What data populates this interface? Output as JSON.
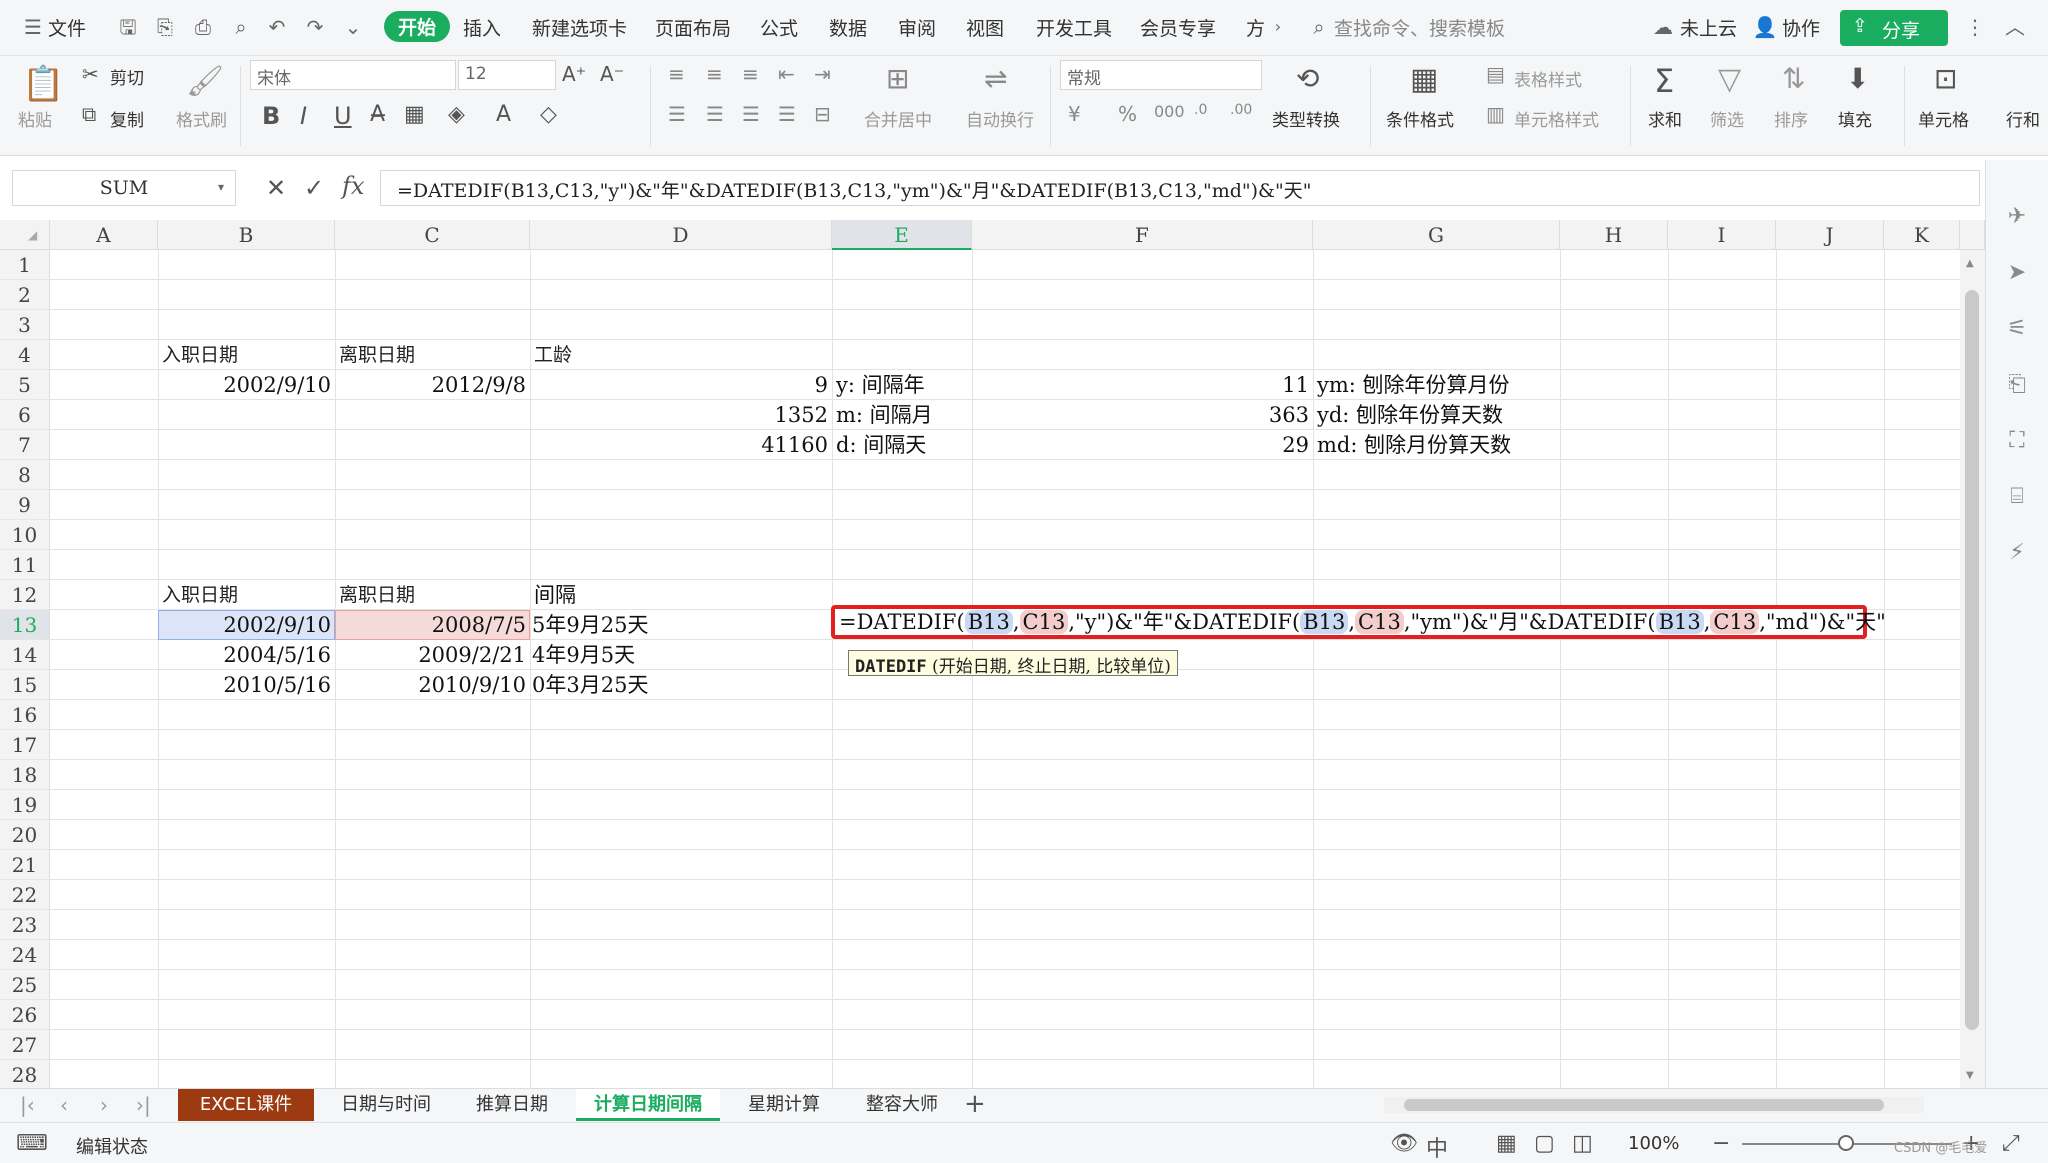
{
  "menubar": {
    "file_label": "文件",
    "tabs": [
      "开始",
      "插入",
      "新建选项卡",
      "页面布局",
      "公式",
      "数据",
      "审阅",
      "视图",
      "开发工具",
      "会员专享",
      "方"
    ],
    "search_placeholder": "查找命令、搜索模板",
    "cloud_label": "未上云",
    "collab_label": "协作",
    "share_label": "分享"
  },
  "toolbar": {
    "paste": "粘贴",
    "cut": "剪切",
    "copy": "复制",
    "format_painter": "格式刷",
    "font_name": "宋体",
    "font_size": "12",
    "merge_center": "合并居中",
    "wrap_text": "自动换行",
    "number_format": "常规",
    "type_convert": "类型转换",
    "cond_format": "条件格式",
    "table_style": "表格样式",
    "cell_style": "单元格样式",
    "sum": "求和",
    "filter": "筛选",
    "sort": "排序",
    "fill": "填充",
    "cell": "单元格",
    "row_col": "行和"
  },
  "formula_bar": {
    "name_box": "SUM",
    "formula": "=DATEDIF(B13,C13,\"y\")&\"年\"&DATEDIF(B13,C13,\"ym\")&\"月\"&DATEDIF(B13,C13,\"md\")&\"天\""
  },
  "columns": [
    "A",
    "B",
    "C",
    "D",
    "E",
    "F",
    "G",
    "H",
    "I",
    "J",
    "K"
  ],
  "rows": [
    "1",
    "2",
    "3",
    "4",
    "5",
    "6",
    "7",
    "8",
    "9",
    "10",
    "11",
    "12",
    "13",
    "14",
    "15",
    "16",
    "17",
    "18",
    "19",
    "20",
    "21",
    "22",
    "23",
    "24",
    "25",
    "26",
    "27",
    "28"
  ],
  "cells": {
    "B4": "入职日期",
    "C4": "离职日期",
    "D4": "工龄",
    "B5": "2002/9/10",
    "C5": "2012/9/8",
    "D5": "9",
    "E5": "y: 间隔年",
    "F5": "11",
    "G5": "ym: 刨除年份算月份",
    "D6": "1352",
    "E6": "m: 间隔月",
    "F6": "363",
    "G6": "yd: 刨除年份算天数",
    "D7": "41160",
    "E7": "d: 间隔天",
    "F7": "29",
    "G7": "md: 刨除月份算天数",
    "B12": "入职日期",
    "C12": "离职日期",
    "D12": "间隔",
    "B13": "2002/9/10",
    "C13": "2008/7/5",
    "D13": "5年9月25天",
    "B14": "2004/5/16",
    "C14": "2009/2/21",
    "D14": "4年9月5天",
    "B15": "2010/5/16",
    "C15": "2010/9/10",
    "D15": "0年3月25天"
  },
  "editor": {
    "p1": "=DATEDIF(",
    "r1": "B13",
    "s1": ",",
    "r2": "C13",
    "p2": ",\"y\")&\"年\"&DATEDIF(",
    "r3": "B13",
    "s2": ",",
    "r4": "C13",
    "p3": ",\"ym\")&\"月\"&DATEDIF(",
    "r5": "B13",
    "s3": ",",
    "r6": "C13",
    "p4": ",\"md\")&\"天\""
  },
  "tooltip": {
    "fn": "DATEDIF",
    "args": " (开始日期, 终止日期, 比较单位)"
  },
  "sheet_tabs": [
    "EXCEL课件",
    "日期与时间",
    "推算日期",
    "计算日期间隔",
    "星期计算",
    "整容大师"
  ],
  "status": {
    "mode": "编辑状态",
    "zoom": "100%",
    "watermark": "CSDN @毛毛爱"
  },
  "colors": {
    "accent": "#1aad5f",
    "highlight_border": "#e32020",
    "first_tab": "#9c3a12"
  }
}
